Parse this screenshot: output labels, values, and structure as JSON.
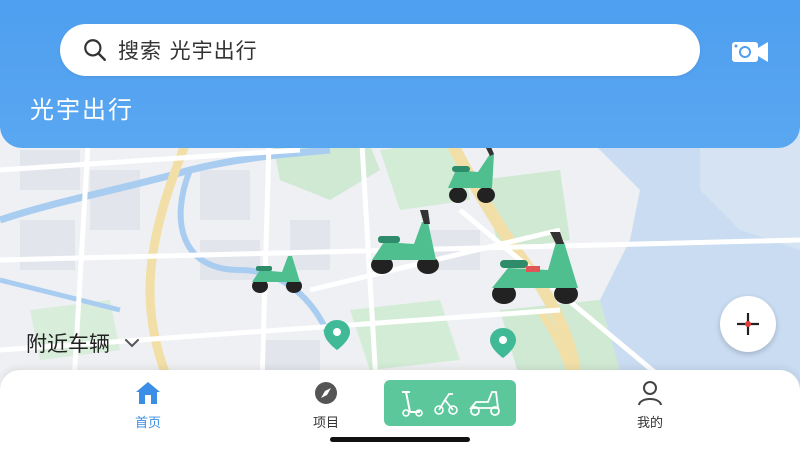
{
  "header": {
    "search_placeholder": "搜索 光宇出行",
    "app_title": "光宇出行"
  },
  "map": {
    "nearby_label": "附近车辆"
  },
  "bottom_nav": {
    "home_label": "首页",
    "project_label": "项目",
    "profile_label": "我的"
  },
  "colors": {
    "header_blue": "#4e9ff0",
    "scooter_green": "#5cc79a",
    "active_blue": "#3a8ee6"
  },
  "icons": [
    "search-icon",
    "camera-icon",
    "chevron-down-icon",
    "add-icon",
    "home-icon",
    "compass-icon",
    "scooter-icon",
    "user-icon"
  ]
}
